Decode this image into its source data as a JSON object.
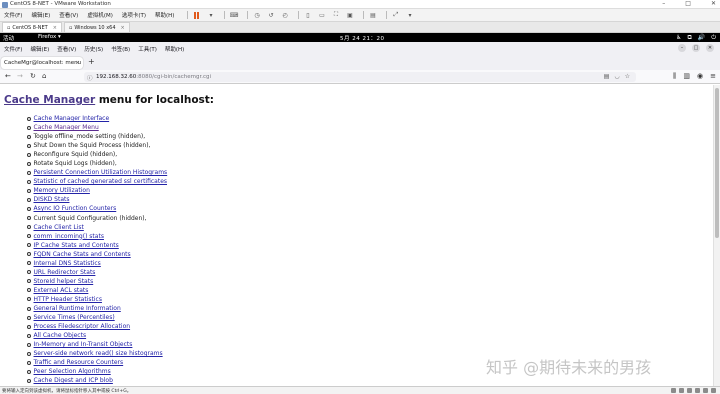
{
  "vmware": {
    "title": "CentOS 8-NET - VMware Workstation",
    "menu": [
      "文件(F)",
      "编辑(E)",
      "查看(V)",
      "虚拟机(M)",
      "选项卡(T)",
      "帮助(H)"
    ],
    "tabs": [
      "CentOS 8-NET",
      "Windows 10 x64"
    ],
    "statusbar": "要将输入定向到该虚拟机，请将鼠标指针移入其中或按 Ctrl+G。"
  },
  "gnome": {
    "activities": "活动",
    "app": "Firefox ▾",
    "clock": "5月 24 21：20"
  },
  "firefox": {
    "menu": [
      "文件(F)",
      "编辑(E)",
      "查看(V)",
      "历史(S)",
      "书签(B)",
      "工具(T)",
      "帮助(H)"
    ],
    "tab_title": "CacheMgr@localhost: menu",
    "url_host": "192.168.32.60",
    "url_path": ":8080/cgi-bin/cachemgr.cgi"
  },
  "page": {
    "title_link": "Cache Manager",
    "title_rest": " menu for localhost:",
    "items": [
      {
        "text": "Cache Manager Interface",
        "link": true,
        "visited": false
      },
      {
        "text": "Cache Manager Menu",
        "link": true,
        "visited": true
      },
      {
        "text": "Toggle offline_mode setting (hidden),",
        "link": false
      },
      {
        "text": "Shut Down the Squid Process (hidden),",
        "link": false
      },
      {
        "text": "Reconfigure Squid (hidden),",
        "link": false
      },
      {
        "text": "Rotate Squid Logs (hidden),",
        "link": false
      },
      {
        "text": "Persistent Connection Utilization Histograms",
        "link": true
      },
      {
        "text": "Statistic of cached generated ssl certificates",
        "link": true
      },
      {
        "text": "Memory Utilization",
        "link": true
      },
      {
        "text": "DISKD Stats",
        "link": true
      },
      {
        "text": "Async IO Function Counters",
        "link": true
      },
      {
        "text": "Current Squid Configuration (hidden),",
        "link": false
      },
      {
        "text": "Cache Client List",
        "link": true
      },
      {
        "text": "comm_incoming() stats",
        "link": true
      },
      {
        "text": "IP Cache Stats and Contents",
        "link": true
      },
      {
        "text": "FQDN Cache Stats and Contents",
        "link": true
      },
      {
        "text": "Internal DNS Statistics",
        "link": true
      },
      {
        "text": "URL Redirector Stats",
        "link": true
      },
      {
        "text": "StoreId helper Stats",
        "link": true
      },
      {
        "text": "External ACL stats",
        "link": true
      },
      {
        "text": "HTTP Header Statistics",
        "link": true
      },
      {
        "text": "General Runtime Information",
        "link": true
      },
      {
        "text": "Service Times (Percentiles)",
        "link": true
      },
      {
        "text": "Process Filedescriptor Allocation",
        "link": true
      },
      {
        "text": "All Cache Objects",
        "link": true
      },
      {
        "text": "In-Memory and In-Transit Objects",
        "link": true
      },
      {
        "text": "Server-side network read() size histograms",
        "link": true
      },
      {
        "text": "Traffic and Resource Counters",
        "link": true
      },
      {
        "text": "Peer Selection Algorithms",
        "link": true
      },
      {
        "text": "Cache Digest and ICP blob",
        "link": true
      }
    ]
  },
  "watermark": "知乎 @期待未来的男孩"
}
